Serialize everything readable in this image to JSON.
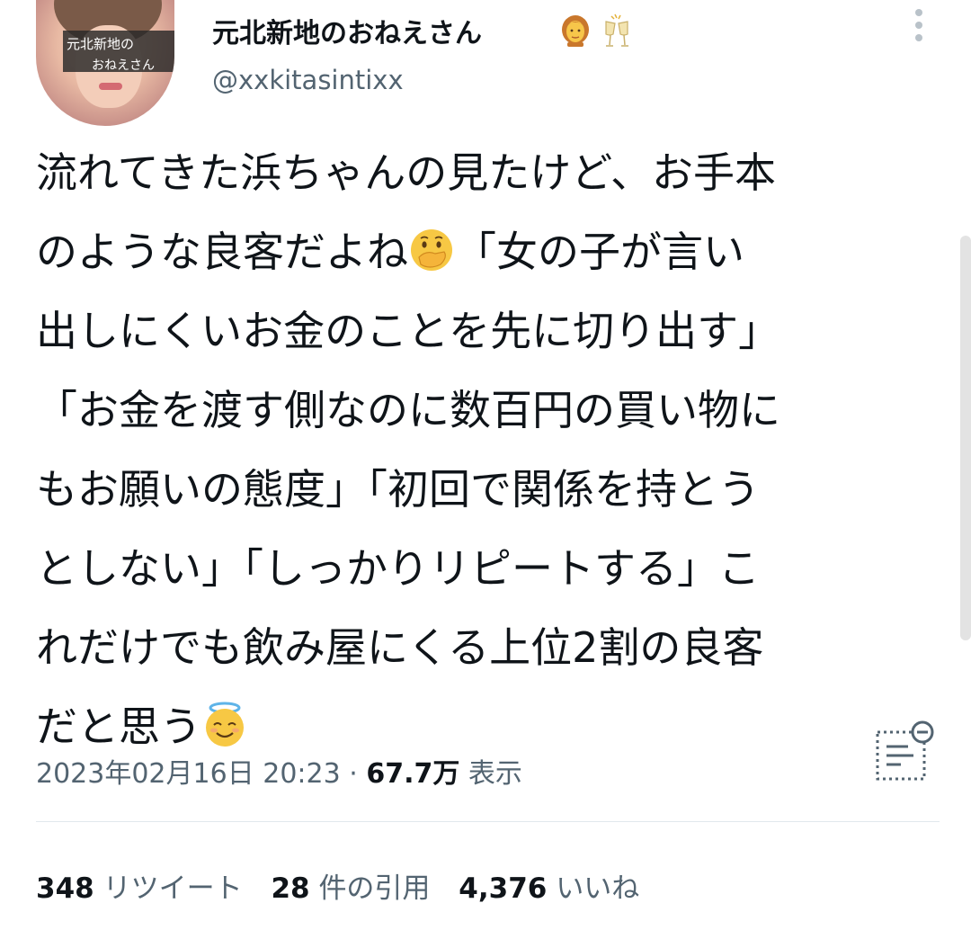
{
  "author": {
    "avatar_label_line1": "元北新地の",
    "avatar_label_line2": "おねえさん",
    "display_name": "元北新地のおねえさん",
    "name_emojis": [
      "woman-emoji",
      "clinking-glasses-emoji"
    ],
    "handle": "@xxkitasintixx"
  },
  "tweet": {
    "lines": [
      "流れてきた浜ちゃんの見たけど、お手本",
      "のような良客だよね",
      "「女の子が言い",
      "出しにくいお金のことを先に切り出す」",
      "「お金を渡す側なのに数百円の買い物に",
      "もお願いの態度」「初回で関係を持とう",
      "としない」「しっかりリピートする」こ",
      "れだけでも飲み屋にくる上位2割の良客",
      "だと思う"
    ],
    "emojis": [
      "hand-over-mouth-emoji",
      "smiling-face-with-halo-emoji"
    ]
  },
  "meta": {
    "timestamp": "2023年02月16日 20:23",
    "separator": "·",
    "views_count": "67.7万",
    "views_label": "表示"
  },
  "stats": {
    "retweets_count": "348",
    "retweets_label": "リツイート",
    "quotes_count": "28",
    "quotes_label": "件の引用",
    "likes_count": "4,376",
    "likes_label": "いいね"
  },
  "colors": {
    "text_primary": "#0f1419",
    "text_secondary": "#536471",
    "divider": "#e1e8ed"
  }
}
